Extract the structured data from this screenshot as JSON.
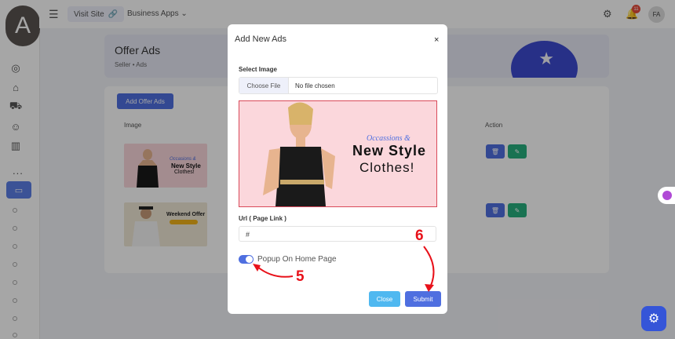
{
  "sidebar": {
    "avatar_letter": "A",
    "more": "..."
  },
  "topbar": {
    "visit_site": "Visit Site",
    "business_apps": "Business Apps",
    "notification_count": "11",
    "user_initials": "FA"
  },
  "page": {
    "title": "Offer Ads",
    "breadcrumb": [
      "Seller",
      "Ads"
    ],
    "add_button": "Add Offer Ads",
    "columns": {
      "image": "Image",
      "action": "Action"
    },
    "rows": [
      {
        "banner_line1": "Occasions &",
        "banner_line2": "New Style",
        "banner_line3": "Clothes!"
      },
      {
        "banner_line1": "Weekend Offer",
        "banner_line2": ""
      }
    ]
  },
  "modal": {
    "title": "Add New Ads",
    "close_glyph": "×",
    "select_image_label": "Select Image",
    "choose_file": "Choose File",
    "no_file": "No file chosen",
    "preview": {
      "line1": "Occassions &",
      "line2": "New Style",
      "line3": "Clothes!"
    },
    "url_label": "Url ( Page Link )",
    "url_value": "#",
    "toggle_label": "Popup On Home Page",
    "toggle_on": true,
    "close_button": "Close",
    "submit_button": "Submit"
  },
  "annotations": {
    "step5": "5",
    "step6": "6"
  },
  "colors": {
    "primary": "#4f6fe0",
    "success": "#27b07f",
    "close_btn": "#4fb8f0",
    "annotation": "#e8111a"
  }
}
